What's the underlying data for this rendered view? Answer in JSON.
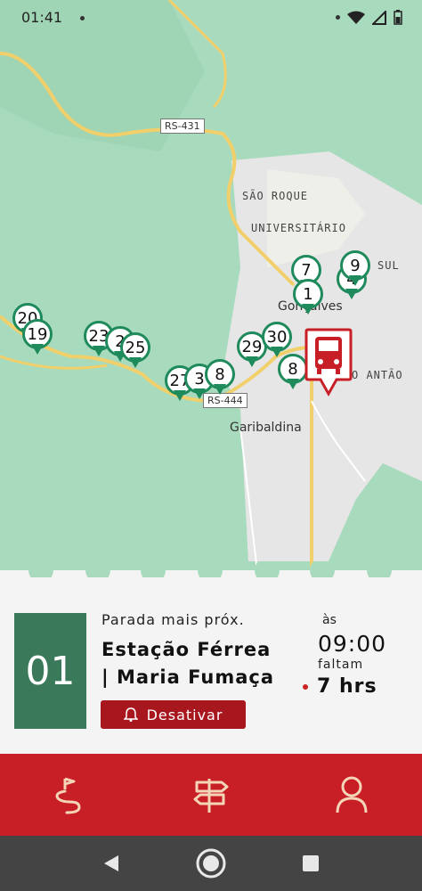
{
  "status_bar": {
    "time": "01:41",
    "icons": [
      "notification-dot-icon",
      "wifi-icon",
      "signal-icon",
      "battery-icon"
    ]
  },
  "map": {
    "labels": {
      "road_rs431": "RS-431",
      "road_rs444": "RS-444",
      "sao_roque": "SÃO ROQUE",
      "universitario": "UNIVERSITÁRIO",
      "garibaldina": "Garibaldina",
      "goncalves": "Gonçalves",
      "sul": "SUL",
      "antao": "O ANTÃO"
    },
    "stop_markers": [
      "20",
      "19",
      "23",
      "2",
      "25",
      "27",
      "3",
      "8",
      "29",
      "30",
      "8",
      "7",
      "1",
      "4",
      "9"
    ],
    "bus_icon": "bus-icon"
  },
  "panel": {
    "stop_number": "01",
    "next_stop_label": "Parada mais próx.",
    "stop_name_line1": "Estação Férrea",
    "stop_name_line2": "| Maria Fumaça",
    "deactivate_label": "Desativar",
    "at_label": "às",
    "time": "09:00",
    "remaining_label": "faltam",
    "remaining_value": "7 hrs"
  },
  "bottom_nav": {
    "items": [
      "route-icon",
      "signpost-icon",
      "person-icon"
    ]
  },
  "colors": {
    "brand_red": "#c81e25",
    "stop_green": "#3a7a5a",
    "marker_green": "#1f8a5c"
  }
}
